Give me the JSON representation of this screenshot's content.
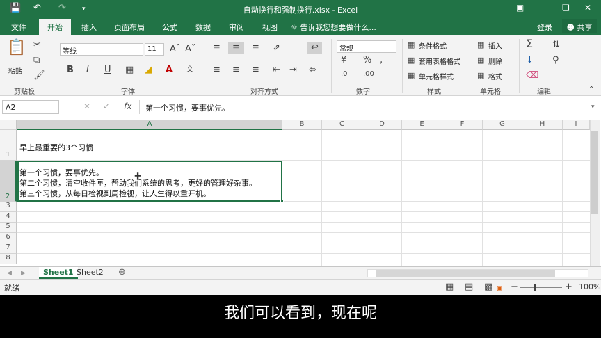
{
  "window": {
    "title": "自动换行和强制换行.xlsx - Excel",
    "quick_access": [
      "save-icon",
      "undo-icon",
      "redo-icon",
      "customize-icon"
    ],
    "controls": [
      "ribbon-display-icon",
      "minimize-icon",
      "restore-icon",
      "close-icon"
    ]
  },
  "tabs": [
    {
      "label": "文件"
    },
    {
      "label": "开始"
    },
    {
      "label": "插入"
    },
    {
      "label": "页面布局"
    },
    {
      "label": "公式"
    },
    {
      "label": "数据"
    },
    {
      "label": "审阅"
    },
    {
      "label": "视图"
    }
  ],
  "tell_me": "告诉我您想要做什么...",
  "login": "登录",
  "share": "共享",
  "ribbon": {
    "clipboard": {
      "paste": "粘贴",
      "label": "剪贴板"
    },
    "font": {
      "name": "等线",
      "size": "11",
      "label": "字体"
    },
    "alignment": {
      "label": "对齐方式"
    },
    "number": {
      "format": "常规",
      "label": "数字"
    },
    "styles": {
      "conditional": "条件格式",
      "table": "套用表格格式",
      "cell": "单元格样式",
      "label": "样式"
    },
    "cells": {
      "insert": "插入",
      "delete": "删除",
      "format": "格式",
      "label": "单元格"
    },
    "editing": {
      "label": "编辑"
    }
  },
  "formula_bar": {
    "name_box": "A2",
    "content": "第一个习惯，要事优先。"
  },
  "columns": [
    "A",
    "B",
    "C",
    "D",
    "E",
    "F",
    "G",
    "H",
    "I"
  ],
  "rows": [
    "1",
    "2",
    "3",
    "4",
    "5",
    "6",
    "7",
    "8"
  ],
  "cells": {
    "A1": "早上最重要的3个习惯",
    "A2_lines": [
      "第一个习惯，要事优先。",
      "第二个习惯，清空收件匣，帮助我们系统的思考，更好的管理好杂事。",
      "第三个习惯，从每日检视到周检视，让人生得以重开机。"
    ]
  },
  "sheets": [
    "Sheet1",
    "Sheet2"
  ],
  "status": {
    "ready": "就绪",
    "zoom": "100%"
  },
  "subtitle": "我们可以看到，现在呢"
}
